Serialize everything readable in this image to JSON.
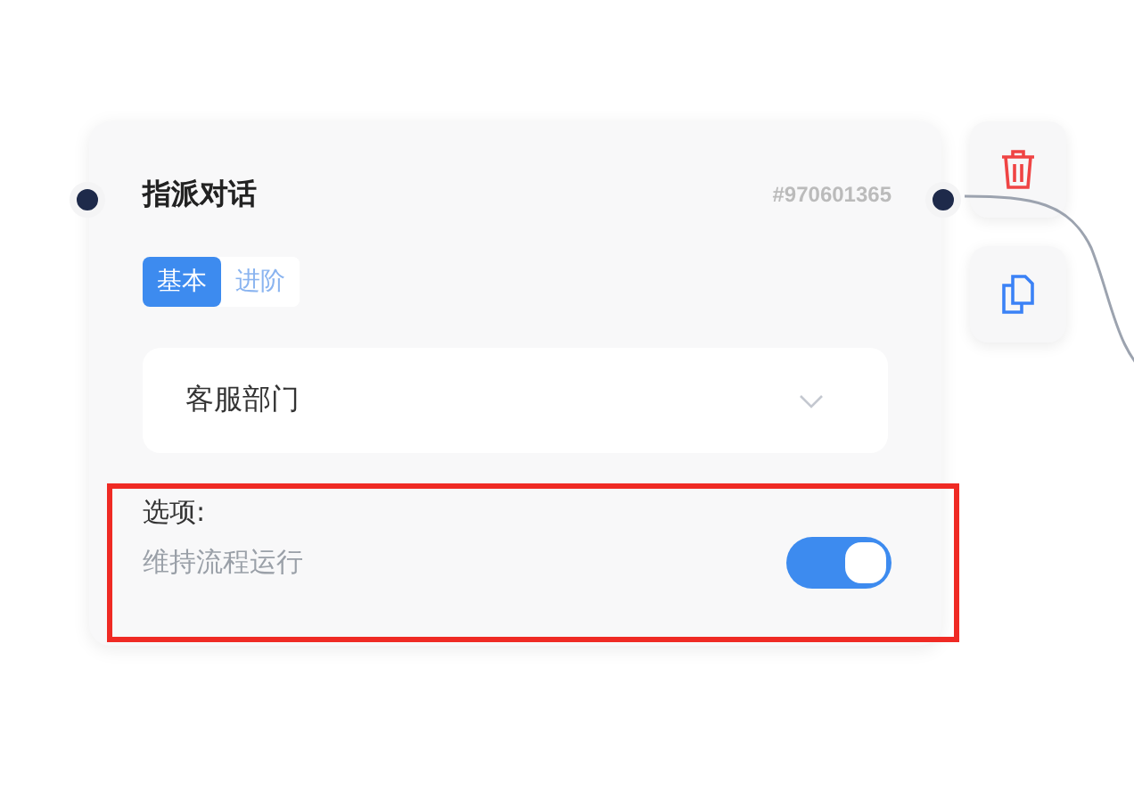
{
  "node": {
    "title": "指派对话",
    "id": "#970601365",
    "tabs": [
      {
        "label": "基本",
        "selected": true
      },
      {
        "label": "进阶",
        "selected": false
      }
    ],
    "dropdown": {
      "value": "客服部门"
    },
    "options": {
      "label": "选项:",
      "highlighted": true,
      "toggle": {
        "label": "维持流程运行",
        "on": true
      }
    }
  },
  "actions": [
    {
      "kind": "delete"
    },
    {
      "kind": "copy"
    }
  ]
}
